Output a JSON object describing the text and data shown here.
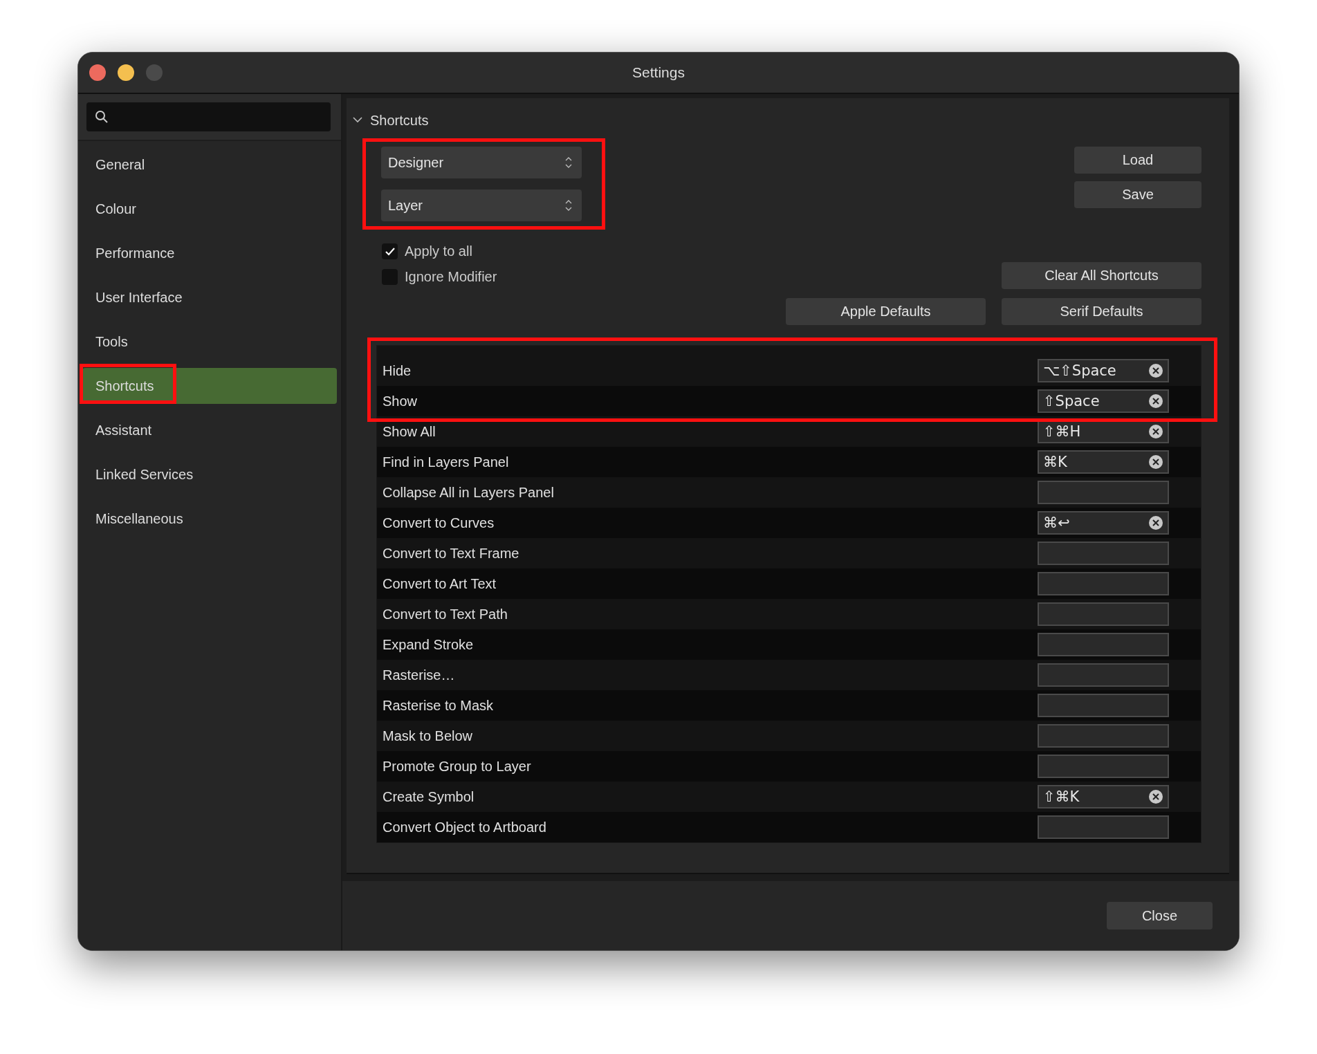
{
  "window": {
    "title": "Settings"
  },
  "sidebar": {
    "items": [
      {
        "label": "General",
        "selected": false
      },
      {
        "label": "Colour",
        "selected": false
      },
      {
        "label": "Performance",
        "selected": false
      },
      {
        "label": "User Interface",
        "selected": false
      },
      {
        "label": "Tools",
        "selected": false
      },
      {
        "label": "Shortcuts",
        "selected": true
      },
      {
        "label": "Assistant",
        "selected": false
      },
      {
        "label": "Linked Services",
        "selected": false
      },
      {
        "label": "Miscellaneous",
        "selected": false
      }
    ]
  },
  "section": {
    "title": "Shortcuts",
    "expanded": true
  },
  "dropdowns": [
    {
      "value": "Designer"
    },
    {
      "value": "Layer"
    }
  ],
  "file_buttons": [
    "Load",
    "Save"
  ],
  "checkboxes": [
    {
      "label": "Apply to all",
      "checked": true
    },
    {
      "label": "Ignore Modifier",
      "checked": false
    }
  ],
  "clear_button": "Clear All Shortcuts",
  "default_buttons": [
    "Apple Defaults",
    "Serif Defaults"
  ],
  "shortcuts": [
    {
      "name": "Hide",
      "shortcut": "⌥⇧Space"
    },
    {
      "name": "Show",
      "shortcut": "⇧Space"
    },
    {
      "name": "Show All",
      "shortcut": "⇧⌘H"
    },
    {
      "name": "Find in Layers Panel",
      "shortcut": "⌘K"
    },
    {
      "name": "Collapse All in Layers Panel"
    },
    {
      "name": "Convert to Curves",
      "shortcut": "⌘↩"
    },
    {
      "name": "Convert to Text Frame"
    },
    {
      "name": "Convert to Art Text"
    },
    {
      "name": "Convert to Text Path"
    },
    {
      "name": "Expand Stroke"
    },
    {
      "name": "Rasterise…"
    },
    {
      "name": "Rasterise to Mask"
    },
    {
      "name": "Mask to Below"
    },
    {
      "name": "Promote Group to Layer"
    },
    {
      "name": "Create Symbol",
      "shortcut": "⇧⌘K"
    },
    {
      "name": "Convert Object to Artboard"
    }
  ],
  "footer": {
    "close_button": "Close"
  }
}
